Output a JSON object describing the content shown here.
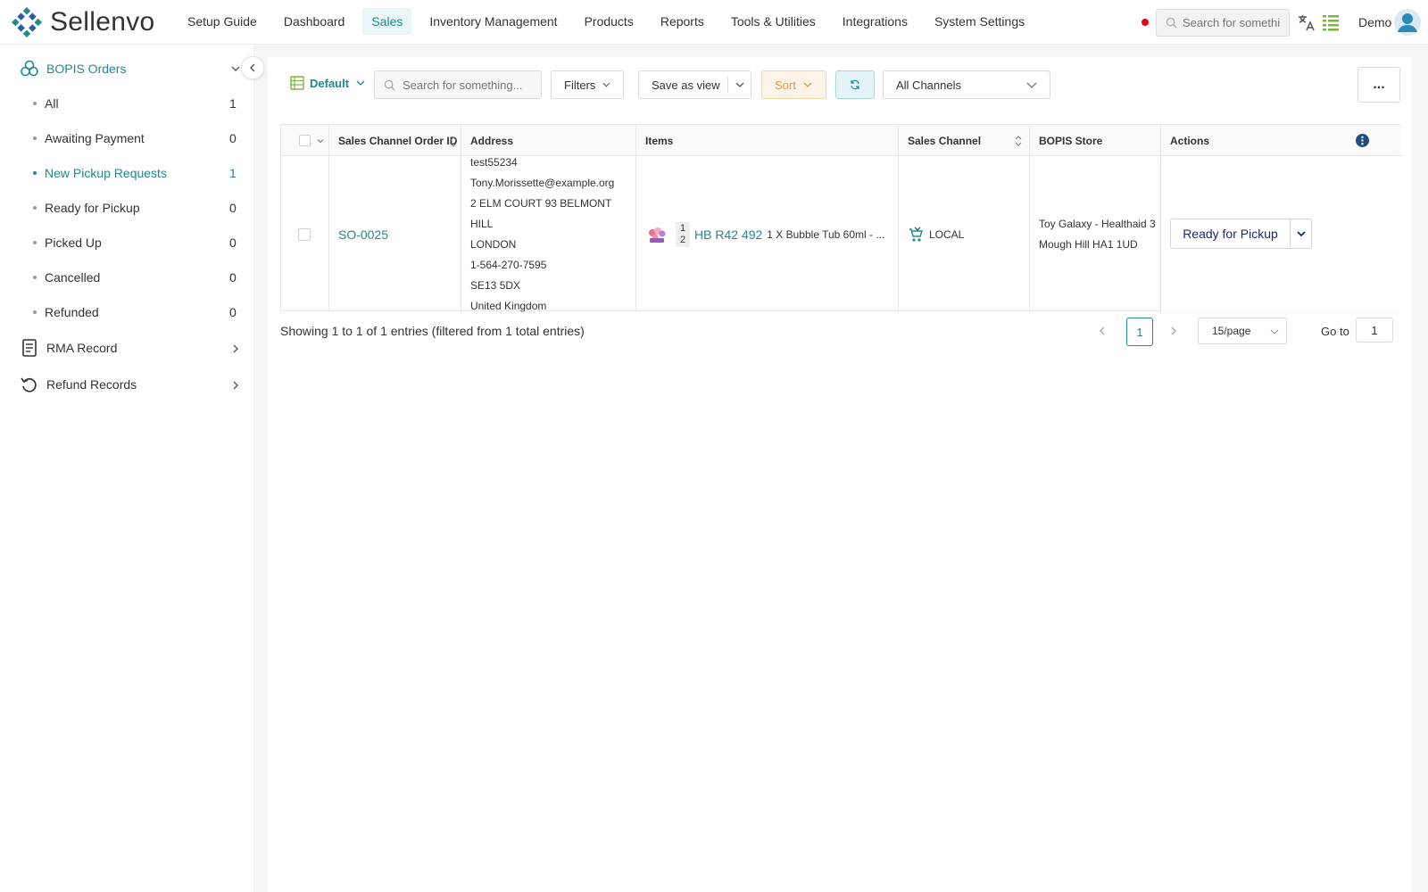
{
  "brand": {
    "name": "Sellenvo"
  },
  "nav": {
    "items": [
      {
        "label": "Setup Guide",
        "active": false
      },
      {
        "label": "Dashboard",
        "active": false
      },
      {
        "label": "Sales",
        "active": true
      },
      {
        "label": "Inventory Management",
        "active": false
      },
      {
        "label": "Products",
        "active": false
      },
      {
        "label": "Reports",
        "active": false
      },
      {
        "label": "Tools & Utilities",
        "active": false
      },
      {
        "label": "Integrations",
        "active": false
      },
      {
        "label": "System Settings",
        "active": false
      }
    ],
    "search_placeholder": "Search for something...",
    "user": "Demo"
  },
  "sidebar": {
    "group": {
      "label": "BOPIS Orders",
      "icon": "bopis-icon",
      "expanded": true
    },
    "items": [
      {
        "label": "All",
        "count": "1",
        "active": false
      },
      {
        "label": "Awaiting Payment",
        "count": "0",
        "active": false
      },
      {
        "label": "New Pickup Requests",
        "count": "1",
        "active": true
      },
      {
        "label": "Ready for Pickup",
        "count": "0",
        "active": false
      },
      {
        "label": "Picked Up",
        "count": "0",
        "active": false
      },
      {
        "label": "Cancelled",
        "count": "0",
        "active": false
      },
      {
        "label": "Refunded",
        "count": "0",
        "active": false
      }
    ],
    "sections": [
      {
        "label": "RMA Record",
        "icon": "document-icon"
      },
      {
        "label": "Refund Records",
        "icon": "refund-icon"
      }
    ]
  },
  "toolbar": {
    "view_label": "Default",
    "search_placeholder": "Search for something...",
    "filters_label": "Filters",
    "save_view_label": "Save as view",
    "sort_label": "Sort",
    "channel_label": "All Channels",
    "more_label": "..."
  },
  "table": {
    "columns": {
      "order_id": "Sales Channel Order ID",
      "address": "Address",
      "items": "Items",
      "channel": "Sales Channel",
      "store": "BOPIS Store",
      "actions": "Actions"
    },
    "rows": [
      {
        "order_id": "SO-0025",
        "address": [
          "test55234",
          "Tony.Morissette@example.org",
          "2 ELM COURT 93 BELMONT HILL",
          "LONDON",
          "1-564-270-7595",
          "SE13 5DX",
          "United Kingdom"
        ],
        "item_qty_top": "1",
        "item_qty_bottom": "2",
        "item_sku": "HB R42 492",
        "item_desc": "1 X Bubble Tub 60ml - ...",
        "channel": "LOCAL",
        "store": "Toy Galaxy - Healthaid 3 Mough Hill HA1 1UD",
        "action_label": "Ready for Pickup"
      }
    ]
  },
  "footer": {
    "summary": "Showing 1 to 1 of 1 entries (filtered from 1 total entries)",
    "current_page": "1",
    "page_size": "15/page",
    "goto_label": "Go to",
    "goto_value": "1"
  },
  "colors": {
    "accent": "#1f8a8f",
    "sort": "#e8953b",
    "status_dot": "#e60012"
  }
}
